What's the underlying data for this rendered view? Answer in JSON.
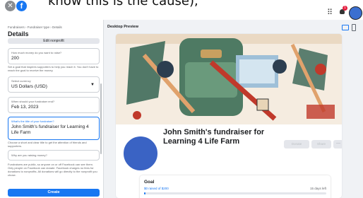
{
  "caption": "know this is the cause),",
  "header": {
    "close_glyph": "✕",
    "logo_letter": "f",
    "notification_count": "1"
  },
  "left": {
    "breadcrumb": "Fundraisers › Fundraiser type › Details",
    "title": "Details",
    "edit_button": "Edit nonprofit",
    "amount_label": "How much money do you want to raise?",
    "amount_value": "200",
    "amount_help": "Set a goal that inspires supporters to help you reach it. You don't have to reach the goal to receive the money.",
    "currency_label": "Select currency",
    "currency_value": "US Dollars (USD)",
    "enddate_label": "When should your fundraiser end?",
    "enddate_value": "Feb 13, 2023",
    "title_label": "What's the title of your fundraiser?",
    "title_value": "John Smith's fundraiser for Learning 4 Life Farm",
    "title_help": "Choose a short and clear title to get the attention of friends and supporters.",
    "why_label": "Why are you raising money?",
    "privacy_text": "Fundraisers are public, so anyone on or off Facebook can see them. Only people on Facebook can donate. Facebook charges no fees for donations to nonprofits. All donations will go directly to the nonprofit you chose.",
    "create_button": "Create"
  },
  "preview": {
    "heading": "Desktop Preview",
    "fundraiser_title": "John Smith's fundraiser for Learning 4 Life Farm",
    "donate_button": "Donate",
    "share_button": "Share",
    "more_button": "···",
    "goal_label": "Goal",
    "goal_raised": "$0 raised of $200",
    "goal_days_left": "15 days left",
    "goal_progress_fraction": 0
  },
  "colors": {
    "brand": "#1877f2",
    "avatar": "#3a63c4",
    "cover_background": "#f5ece0"
  }
}
